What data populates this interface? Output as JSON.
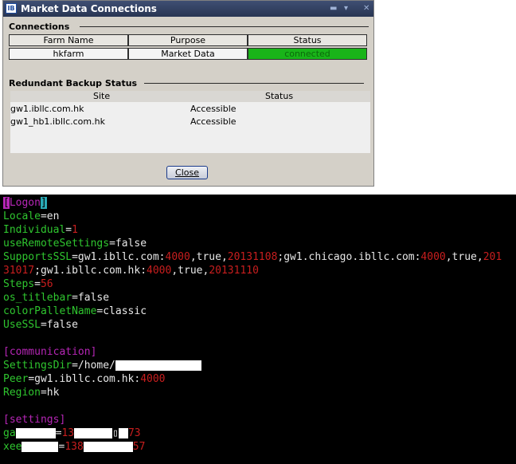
{
  "dialog": {
    "logo": "IB",
    "title": "Market Data Connections",
    "connections_header": "Connections",
    "columns": [
      "Farm Name",
      "Purpose",
      "Status"
    ],
    "row": {
      "farm": "hkfarm",
      "purpose": "Market Data",
      "status": "connected"
    },
    "backup_header": "Redundant Backup Status",
    "backup_columns": [
      "Site",
      "Status"
    ],
    "backup_rows": [
      {
        "site": "gw1.ibllc.com.hk",
        "status": "Accessible"
      },
      {
        "site": "gw1_hb1.ibllc.com.hk",
        "status": "Accessible"
      }
    ],
    "close_label": "Close",
    "status_color": "#19b419"
  },
  "terminal": {
    "section_logon": "Logon",
    "locale_key": "Locale",
    "locale_val": "en",
    "individual_key": "Individual",
    "individual_val": "1",
    "remote_key": "useRemoteSettings",
    "remote_val": "false",
    "ssl_key": "SupportsSSL",
    "ssl_l1": [
      "gw1.ibllc.com",
      "4000",
      ",true,",
      "20131108",
      ";gw1.chicago.ibllc.com",
      "4000",
      ",true,",
      "201"
    ],
    "ssl_l2": [
      "31017",
      ";gw1.ibllc.com.hk",
      "4000",
      ",true,",
      "20131110"
    ],
    "steps_key": "Steps",
    "steps_val": "56",
    "titlebar_key": "os_titlebar",
    "titlebar_val": "false",
    "pallet_key": "colorPalletName",
    "pallet_val": "classic",
    "usessl_key": "UseSSL",
    "usessl_val": "false",
    "section_comm": "[communication]",
    "settingsdir_key": "SettingsDir",
    "settingsdir_val": "/home/",
    "peer_key": "Peer",
    "peer_host": "gw1.ibllc.com.hk",
    "peer_port": "4000",
    "region_key": "Region",
    "region_val": "hk",
    "section_settings": "[settings]",
    "ga_key": "ga",
    "ga_v1": "13",
    "ga_v2": "73",
    "xee_key": "xee",
    "xee_v1": "138",
    "xee_v2": "57"
  }
}
